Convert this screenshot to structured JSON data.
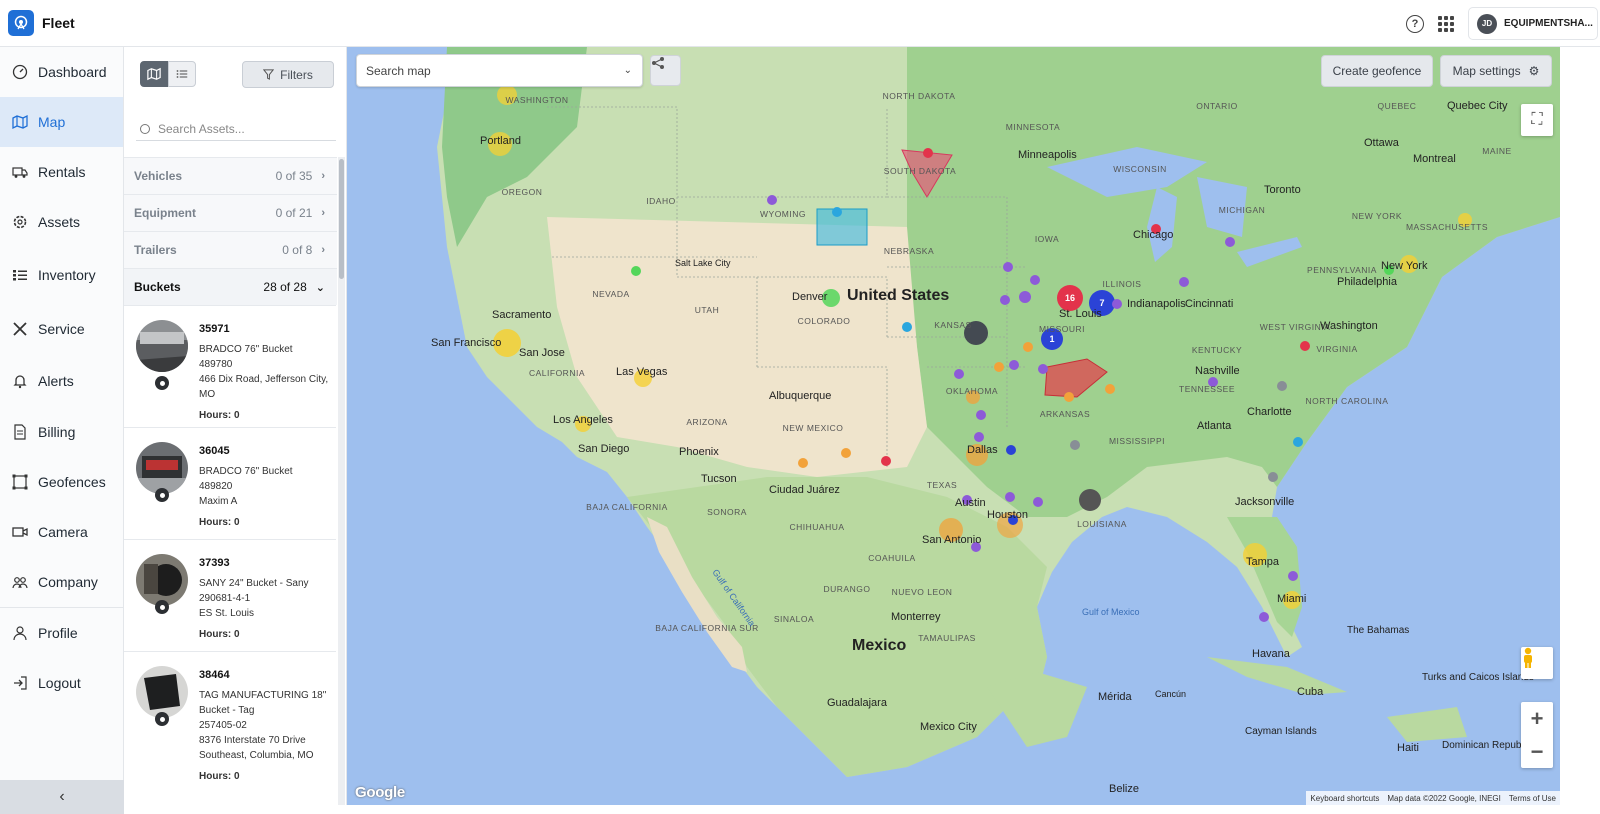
{
  "app": {
    "title": "Fleet",
    "account_initials": "JD",
    "account_name": "EQUIPMENTSHA..."
  },
  "nav": {
    "items": [
      {
        "label": "Dashboard"
      },
      {
        "label": "Map"
      },
      {
        "label": "Rentals"
      },
      {
        "label": "Assets"
      },
      {
        "label": "Inventory"
      },
      {
        "label": "Service"
      },
      {
        "label": "Alerts"
      },
      {
        "label": "Billing"
      },
      {
        "label": "Geofences"
      },
      {
        "label": "Camera"
      },
      {
        "label": "Company"
      },
      {
        "label": "Profile"
      },
      {
        "label": "Logout"
      }
    ],
    "active": "Map",
    "collapse_glyph": "‹"
  },
  "panel": {
    "filters_label": "Filters",
    "search_placeholder": "Search Assets...",
    "categories": [
      {
        "name": "Vehicles",
        "count": "0 of 35"
      },
      {
        "name": "Equipment",
        "count": "0 of 21"
      },
      {
        "name": "Trailers",
        "count": "0 of 8"
      },
      {
        "name": "Buckets",
        "count": "28 of 28"
      }
    ],
    "assets": [
      {
        "id": "35971",
        "line1": "BRADCO 76\" Bucket",
        "line2": "489780",
        "line3": "466 Dix Road, Jefferson City, MO",
        "hours_label": "Hours:",
        "hours": "0"
      },
      {
        "id": "36045",
        "line1": "BRADCO 76\" Bucket",
        "line2": "489820",
        "line3": "Maxim A",
        "hours_label": "Hours:",
        "hours": "0"
      },
      {
        "id": "37393",
        "line1": "SANY 24\" Bucket - Sany",
        "line2": "290681-4-1",
        "line3": "ES St. Louis",
        "hours_label": "Hours:",
        "hours": "0"
      },
      {
        "id": "38464",
        "line1": "TAG MANUFACTURING 18\" Bucket - Tag",
        "line2": "257405-02",
        "line3": "8376 Interstate 70 Drive Southeast, Columbia, MO",
        "hours_label": "Hours:",
        "hours": "0"
      }
    ]
  },
  "map": {
    "search_placeholder": "Search map",
    "create_geofence_label": "Create geofence",
    "map_settings_label": "Map settings",
    "google_logo": "Google",
    "attribution": [
      "Keyboard shortcuts",
      "Map data ©2022 Google, INEGI",
      "Terms of Use"
    ],
    "labels": {
      "country_us": "United States",
      "country_mx": "Mexico",
      "states": [
        "WASHINGTON",
        "OREGON",
        "IDAHO",
        "NEVADA",
        "UTAH",
        "CALIFORNIA",
        "ARIZONA",
        "NEW MEXICO",
        "COLORADO",
        "WYOMING",
        "NEBRASKA",
        "KANSAS",
        "OKLAHOMA",
        "TEXAS",
        "NORTH DAKOTA",
        "SOUTH DAKOTA",
        "MINNESOTA",
        "IOWA",
        "MISSOURI",
        "ARKANSAS",
        "LOUISIANA",
        "MISSISSIPPI",
        "ILLINOIS",
        "WISCONSIN",
        "MICHIGAN",
        "KENTUCKY",
        "TENNESSEE",
        "NEW YORK",
        "PENNSYLVANIA",
        "NORTH CAROLINA",
        "WEST VIRGINIA",
        "VIRGINIA",
        "MAINE",
        "MASSACHUSETTS",
        "ONTARIO",
        "QUEBEC",
        "SONORA",
        "CHIHUAHUA",
        "COAHUILA",
        "DURANGO",
        "SINALOA",
        "NUEVO LEON",
        "TAMAULIPAS",
        "BAJA CALIFORNIA",
        "BAJA CALIFORNIA SUR"
      ],
      "cities": [
        "Portland",
        "Sacramento",
        "San Francisco",
        "San Jose",
        "Las Vegas",
        "Los Angeles",
        "San Diego",
        "Phoenix",
        "Tucson",
        "Salt Lake City",
        "Denver",
        "Albuquerque",
        "Ciudad Juárez",
        "Dallas",
        "Austin",
        "Houston",
        "San Antonio",
        "Monterrey",
        "Minneapolis",
        "Chicago",
        "Indianapolis",
        "St. Louis",
        "Cincinnati",
        "Nashville",
        "Atlanta",
        "Charlotte",
        "Jacksonville",
        "Tampa",
        "Miami",
        "Washington",
        "Philadelphia",
        "New York",
        "Toronto",
        "Ottawa",
        "Montreal",
        "Quebec City",
        "Havana",
        "Mérida",
        "Cancún",
        "Guadalajara",
        "Mexico City",
        "Belize",
        "Cuba",
        "Haiti",
        "Dominican Republic",
        "Cayman Islands",
        "The Bahamas",
        "Turks and Caicos Islands"
      ],
      "water": [
        "Gulf of California",
        "Gulf of Mexico"
      ]
    },
    "cluster_counts": [
      "16",
      "7",
      "1"
    ]
  },
  "colors": {
    "accent": "#1f6fd6",
    "active_nav_bg": "#dde9f8"
  }
}
